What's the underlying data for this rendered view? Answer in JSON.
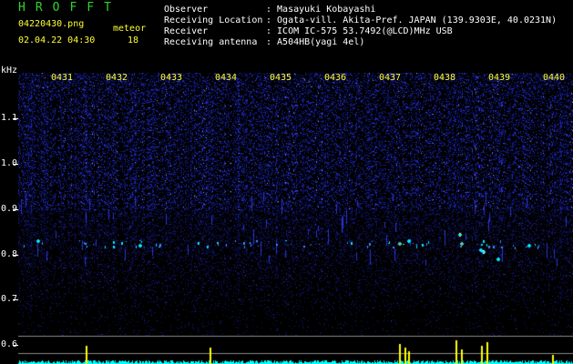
{
  "header": {
    "brand": "HROFFT",
    "filename": "04220430.png",
    "datetime": "02.04.22 04:30",
    "meteor_label": "meteor",
    "meteor_count": "18",
    "info": [
      {
        "label": "Observer",
        "value": ": Masayuki Kobayashi"
      },
      {
        "label": "Receiving Location",
        "value": ": Ogata-vill. Akita-Pref. JAPAN (139.9303E, 40.0231N)"
      },
      {
        "label": "Receiver",
        "value": ": ICOM IC-575 53.7492(@LCD)MHz USB"
      },
      {
        "label": "Receiving antenna",
        "value": ": A504HB(yagi 4el)"
      }
    ]
  },
  "axis": {
    "y_unit": "kHz",
    "y_ticks": [
      "1.1",
      "1.0",
      "0.9",
      "0.8",
      "0.7",
      "0.6"
    ],
    "x_ticks": [
      "0431",
      "0432",
      "0433",
      "0434",
      "0435",
      "0436",
      "0437",
      "0438",
      "0439",
      "0440"
    ]
  },
  "colors": {
    "background": "#000000",
    "brand_green": "#2fd42f",
    "label_white": "#ffffff",
    "label_yellow": "#ffff33",
    "noise_blue": "#1e28c8",
    "meteor_cyan": "#00e6ff",
    "meteor_yellow": "#ffff00",
    "meteor_orange": "#ff8800",
    "power_cyan": "#00ffff"
  }
}
